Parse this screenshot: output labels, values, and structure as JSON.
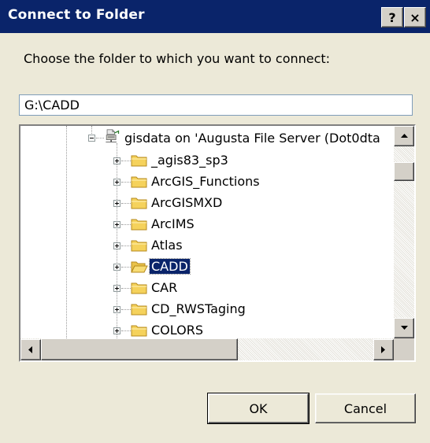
{
  "window": {
    "title": "Connect to Folder",
    "help_label": "?",
    "close_label": "×"
  },
  "prompt": "Choose the folder to which you want to connect:",
  "path_value": "G:\\CADD",
  "tree": {
    "root": {
      "label": "gisdata on 'Augusta File Server (Dot0dta",
      "icon": "network-drive-icon",
      "expanded": true
    },
    "items": [
      {
        "label": "_agis83_sp3",
        "selected": false
      },
      {
        "label": "ArcGIS_Functions",
        "selected": false
      },
      {
        "label": "ArcGISMXD",
        "selected": false
      },
      {
        "label": "ArcIMS",
        "selected": false
      },
      {
        "label": "Atlas",
        "selected": false
      },
      {
        "label": "CADD",
        "selected": true
      },
      {
        "label": "CAR",
        "selected": false
      },
      {
        "label": "CD_RWSTaging",
        "selected": false
      },
      {
        "label": "COLORS",
        "selected": false
      }
    ]
  },
  "buttons": {
    "ok": "OK",
    "cancel": "Cancel"
  },
  "colors": {
    "titlebar": "#0a246a",
    "dialog_bg": "#ece9d8",
    "selection": "#0a246a",
    "folder": "#f5d25c"
  }
}
